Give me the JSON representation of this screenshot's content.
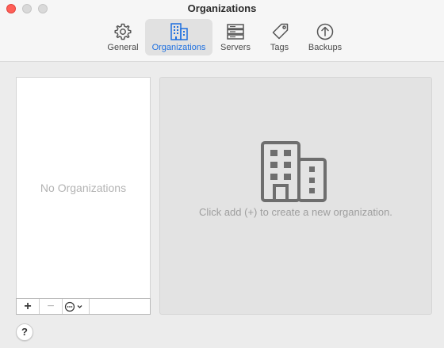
{
  "window": {
    "title": "Organizations"
  },
  "tabs": [
    {
      "label": "General",
      "icon": "gear-icon",
      "active": false
    },
    {
      "label": "Organizations",
      "icon": "buildings-icon",
      "active": true
    },
    {
      "label": "Servers",
      "icon": "server-icon",
      "active": false
    },
    {
      "label": "Tags",
      "icon": "tag-icon",
      "active": false
    },
    {
      "label": "Backups",
      "icon": "upload-circle-icon",
      "active": false
    }
  ],
  "list": {
    "empty_text": "No Organizations",
    "toolbar": {
      "add_label": "+",
      "remove_label": "−",
      "action_icon": "ellipsis-circle-icon",
      "action_menu_icon": "chevron-down-icon"
    }
  },
  "detail": {
    "icon": "buildings-icon",
    "hint": "Click add (+) to create a new organization."
  },
  "help": {
    "label": "?"
  },
  "colors": {
    "accent": "#1d6fe0",
    "close": "#ff5f57",
    "window_bg": "#ececec",
    "pane_bg": "#e3e3e3"
  }
}
